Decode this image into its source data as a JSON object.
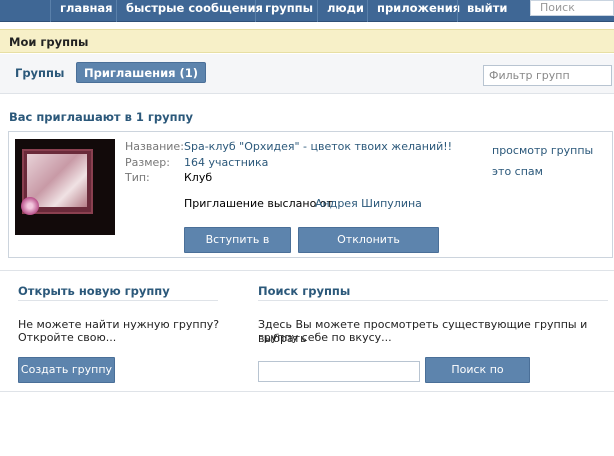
{
  "nav": {
    "items": [
      "главная",
      "быстрые сообщения",
      "группы",
      "люди",
      "приложения",
      "выйти"
    ],
    "search_placeholder": "Поиск"
  },
  "page_title": "Мои группы",
  "tabs": {
    "groups": "Группы",
    "invitations": "Приглашения (1)"
  },
  "filter_placeholder": "Фильтр групп",
  "invites_header": "Вас приглашают в 1 группу",
  "invite": {
    "name_label": "Название:",
    "name_value": "Spa-клуб \"Орхидея\" - цветок твоих желаний!!",
    "size_label": "Размер:",
    "size_value": "164 участника",
    "type_label": "Тип:",
    "type_value": "Клуб",
    "sent_by_text": "Приглашение выслано от",
    "sender": "Андрея Шипулина",
    "join_button": "Вступить в группу",
    "decline_button": "Отклонить приглашение",
    "view_link": "просмотр группы",
    "spam_link": "это спам"
  },
  "create": {
    "title": "Открыть новую группу",
    "text_line1": "Не можете найти нужную группу?",
    "text_line2": "Откройте свою...",
    "button": "Создать группу"
  },
  "search": {
    "title": "Поиск группы",
    "text_line1": "Здесь Вы можете просмотреть существующие группы и выбрать",
    "text_line2": "группу себе по вкусу...",
    "button": "Поиск по группам"
  },
  "colors": {
    "nav_bg": "#3f6795",
    "button_bg": "#5d84ad",
    "link": "#2b587a",
    "title_bar_bg": "#f7f0c8"
  }
}
